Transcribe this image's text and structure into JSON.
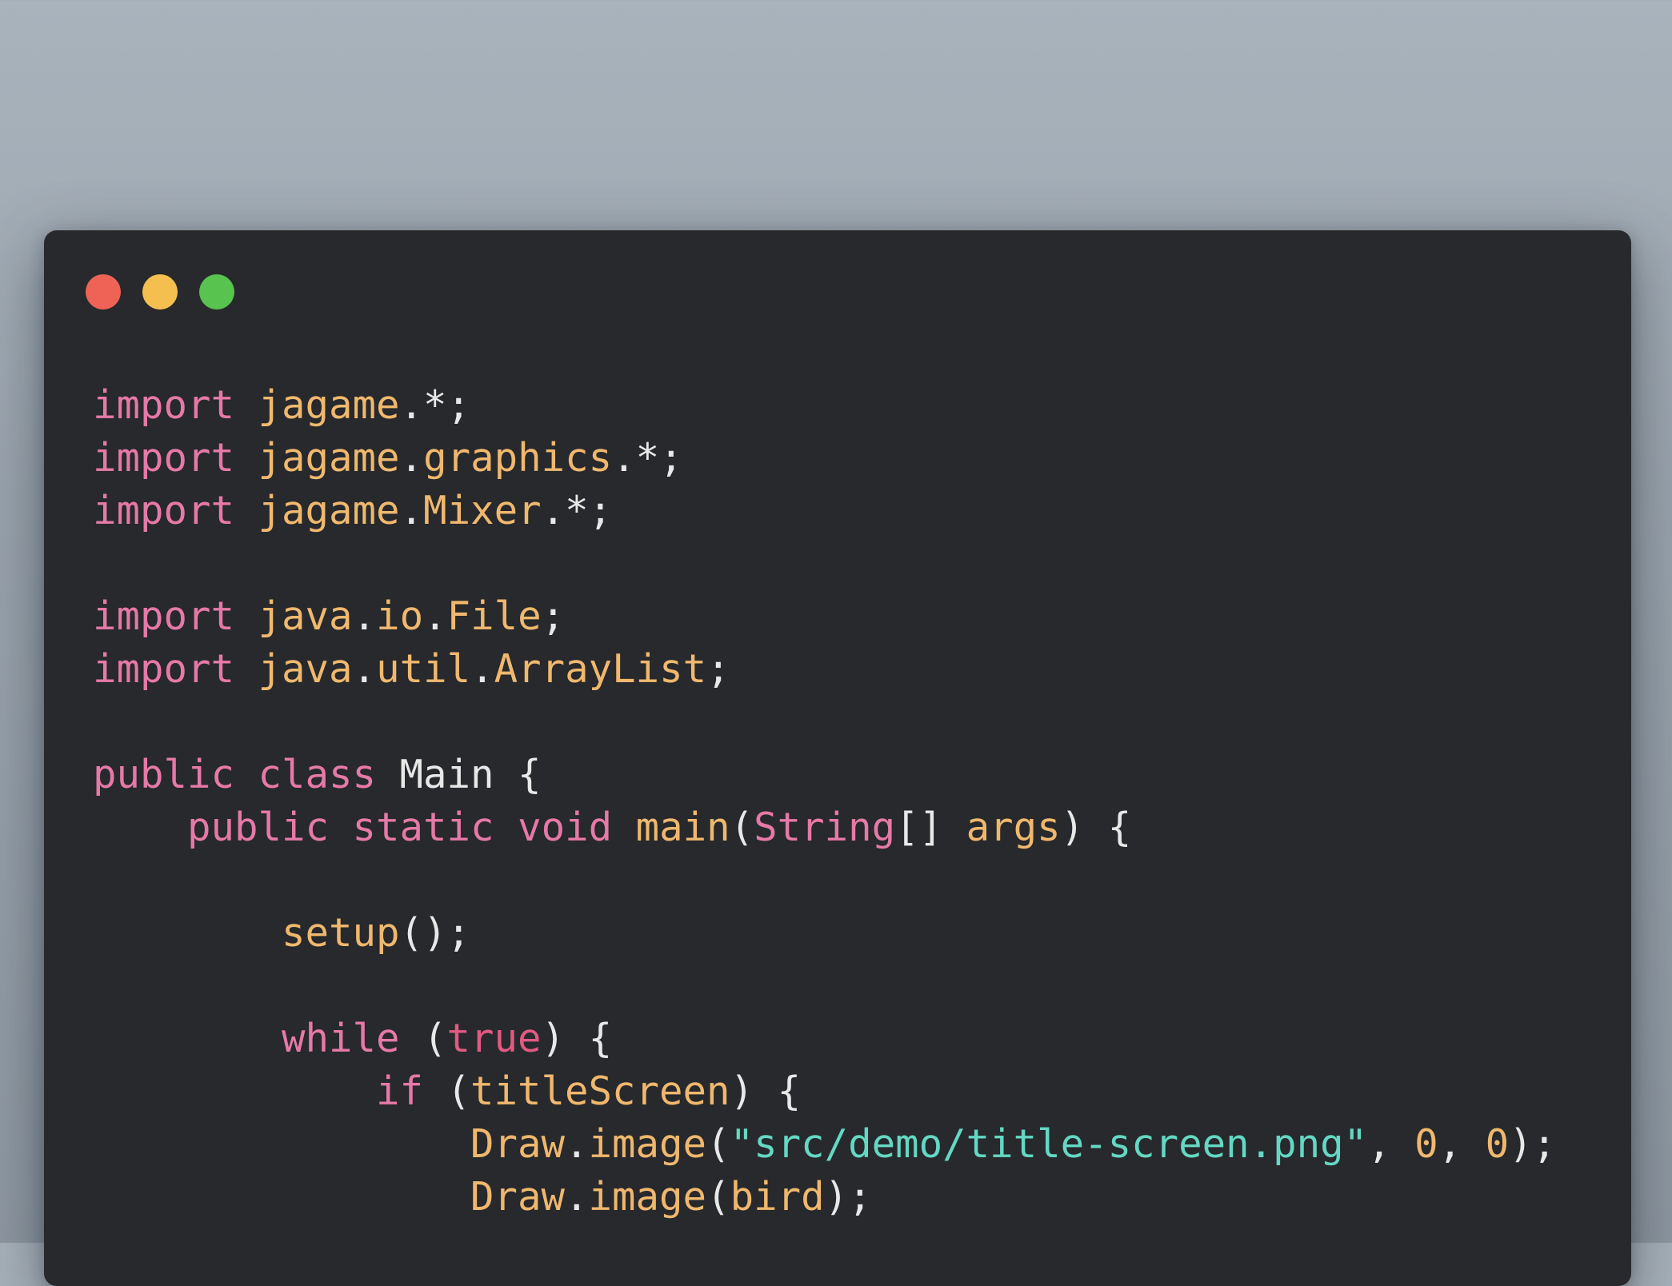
{
  "window": {
    "buttons": [
      {
        "name": "close",
        "color": "#ef6357"
      },
      {
        "name": "minimize",
        "color": "#f5bf4f"
      },
      {
        "name": "zoom",
        "color": "#58c34e"
      }
    ]
  },
  "theme": {
    "keyword": "#e679a7",
    "identifier": "#f0b86e",
    "plain": "#e8e8e8",
    "string": "#64d8c3",
    "number": "#f0b86e",
    "boolean": "#e05a82"
  },
  "code_lines": [
    [
      [
        "keyword",
        "import"
      ],
      [
        "plain",
        " "
      ],
      [
        "ident",
        "jagame"
      ],
      [
        "plain",
        ".*;"
      ]
    ],
    [
      [
        "keyword",
        "import"
      ],
      [
        "plain",
        " "
      ],
      [
        "ident",
        "jagame"
      ],
      [
        "plain",
        "."
      ],
      [
        "ident",
        "graphics"
      ],
      [
        "plain",
        ".*;"
      ]
    ],
    [
      [
        "keyword",
        "import"
      ],
      [
        "plain",
        " "
      ],
      [
        "ident",
        "jagame"
      ],
      [
        "plain",
        "."
      ],
      [
        "ident",
        "Mixer"
      ],
      [
        "plain",
        ".*;"
      ]
    ],
    [],
    [
      [
        "keyword",
        "import"
      ],
      [
        "plain",
        " "
      ],
      [
        "ident",
        "java"
      ],
      [
        "plain",
        "."
      ],
      [
        "ident",
        "io"
      ],
      [
        "plain",
        "."
      ],
      [
        "ident",
        "File"
      ],
      [
        "plain",
        ";"
      ]
    ],
    [
      [
        "keyword",
        "import"
      ],
      [
        "plain",
        " "
      ],
      [
        "ident",
        "java"
      ],
      [
        "plain",
        "."
      ],
      [
        "ident",
        "util"
      ],
      [
        "plain",
        "."
      ],
      [
        "ident",
        "ArrayList"
      ],
      [
        "plain",
        ";"
      ]
    ],
    [],
    [
      [
        "keyword",
        "public"
      ],
      [
        "plain",
        " "
      ],
      [
        "keyword",
        "class"
      ],
      [
        "plain",
        " Main {"
      ]
    ],
    [
      [
        "plain",
        "    "
      ],
      [
        "keyword",
        "public"
      ],
      [
        "plain",
        " "
      ],
      [
        "keyword",
        "static"
      ],
      [
        "plain",
        " "
      ],
      [
        "keyword",
        "void"
      ],
      [
        "plain",
        " "
      ],
      [
        "ident",
        "main"
      ],
      [
        "plain",
        "("
      ],
      [
        "keyword",
        "String"
      ],
      [
        "plain",
        "[] "
      ],
      [
        "ident",
        "args"
      ],
      [
        "plain",
        ") {"
      ]
    ],
    [],
    [
      [
        "plain",
        "        "
      ],
      [
        "ident",
        "setup"
      ],
      [
        "plain",
        "();"
      ]
    ],
    [],
    [
      [
        "plain",
        "        "
      ],
      [
        "keyword",
        "while"
      ],
      [
        "plain",
        " ("
      ],
      [
        "bool",
        "true"
      ],
      [
        "plain",
        ") {"
      ]
    ],
    [
      [
        "plain",
        "            "
      ],
      [
        "keyword",
        "if"
      ],
      [
        "plain",
        " ("
      ],
      [
        "ident",
        "titleScreen"
      ],
      [
        "plain",
        ") {"
      ]
    ],
    [
      [
        "plain",
        "                "
      ],
      [
        "ident",
        "Draw"
      ],
      [
        "plain",
        "."
      ],
      [
        "ident",
        "image"
      ],
      [
        "plain",
        "("
      ],
      [
        "string",
        "\"src/demo/title-screen.png\""
      ],
      [
        "plain",
        ", "
      ],
      [
        "number",
        "0"
      ],
      [
        "plain",
        ", "
      ],
      [
        "number",
        "0"
      ],
      [
        "plain",
        ");"
      ]
    ],
    [
      [
        "plain",
        "                "
      ],
      [
        "ident",
        "Draw"
      ],
      [
        "plain",
        "."
      ],
      [
        "ident",
        "image"
      ],
      [
        "plain",
        "("
      ],
      [
        "ident",
        "bird"
      ],
      [
        "plain",
        ");"
      ]
    ]
  ]
}
